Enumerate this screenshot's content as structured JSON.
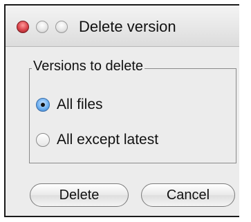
{
  "window": {
    "title": "Delete version"
  },
  "group": {
    "label": "Versions to delete",
    "options": [
      {
        "label": "All files",
        "selected": true
      },
      {
        "label": "All except latest",
        "selected": false
      }
    ]
  },
  "buttons": {
    "delete_label": "Delete",
    "cancel_label": "Cancel"
  }
}
